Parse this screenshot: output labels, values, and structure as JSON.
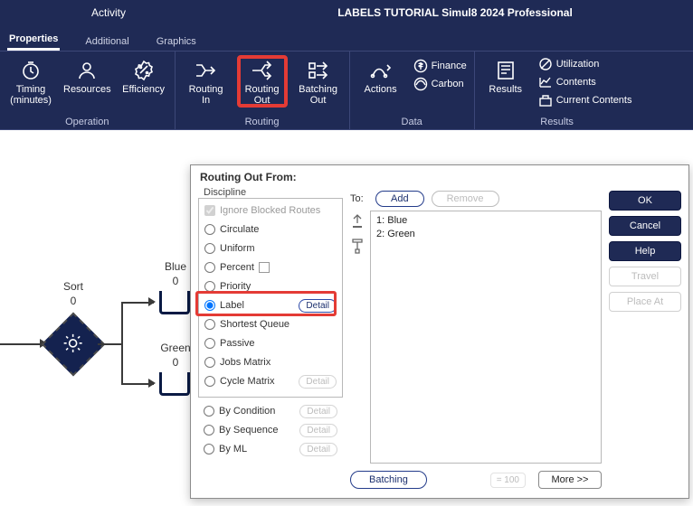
{
  "header": {
    "section": "Activity",
    "app_title": "LABELS TUTORIAL   Simul8 2024 Professional",
    "tabs": [
      "Properties",
      "Additional",
      "Graphics"
    ],
    "active_tab": 0
  },
  "ribbon": {
    "operation": {
      "label": "Operation",
      "timing": "Timing\n(minutes)",
      "resources": "Resources",
      "efficiency": "Efficiency"
    },
    "routing": {
      "label": "Routing",
      "in": "Routing\nIn",
      "out": "Routing\nOut",
      "batching": "Batching\nOut"
    },
    "data": {
      "label": "Data",
      "actions": "Actions",
      "finance": "Finance",
      "carbon": "Carbon"
    },
    "results": {
      "label": "Results",
      "results": "Results",
      "utilization": "Utilization",
      "contents": "Contents",
      "current_contents": "Current Contents"
    }
  },
  "canvas": {
    "sort": {
      "label": "Sort",
      "count": "0"
    },
    "queues": [
      {
        "label": "Blue",
        "count": "0"
      },
      {
        "label": "Green",
        "count": "0"
      }
    ]
  },
  "dialog": {
    "title": "Routing Out From:",
    "discipline_label": "Discipline",
    "ignore_blocked": "Ignore Blocked Routes",
    "options": {
      "circulate": "Circulate",
      "uniform": "Uniform",
      "percent": "Percent",
      "priority": "Priority",
      "label": "Label",
      "shortest": "Shortest Queue",
      "passive": "Passive",
      "jobs_matrix": "Jobs Matrix",
      "cycle_matrix": "Cycle Matrix",
      "by_condition": "By Condition",
      "by_sequence": "By Sequence",
      "by_ml": "By ML"
    },
    "selected": "label",
    "detail": "Detail",
    "to_label": "To:",
    "add": "Add",
    "remove": "Remove",
    "destinations": [
      "1: Blue",
      "2: Green"
    ],
    "batching": "Batching",
    "eq100": "= 100",
    "more": "More >>",
    "buttons": {
      "ok": "OK",
      "cancel": "Cancel",
      "help": "Help",
      "travel": "Travel",
      "place_at": "Place At"
    }
  }
}
